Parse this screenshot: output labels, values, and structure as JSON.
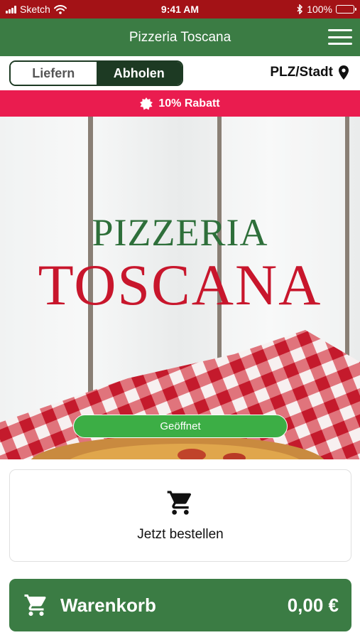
{
  "status_bar": {
    "carrier": "Sketch",
    "time": "9:41 AM",
    "battery": "100%",
    "icons": [
      "signal-icon",
      "wifi-icon",
      "bluetooth-icon",
      "battery-icon"
    ]
  },
  "nav": {
    "title": "Pizzeria Toscana",
    "menu_icon": "hamburger-menu-icon"
  },
  "mode": {
    "options": [
      "Liefern",
      "Abholen"
    ],
    "selected": "Abholen",
    "location_label": "PLZ/Stadt",
    "location_icon": "map-pin-icon"
  },
  "discount": {
    "label": "10% Rabatt",
    "icon": "badge-icon"
  },
  "hero": {
    "brand_line1": "PIZZERIA",
    "brand_line2": "TOSCANA",
    "status": "Geöffnet"
  },
  "order": {
    "label": "Jetzt bestellen",
    "icon": "cart-icon"
  },
  "cart": {
    "label": "Warenkorb",
    "total": "0,00 €",
    "icon": "cart-icon"
  },
  "colors": {
    "status_bar": "#a31216",
    "brand_green": "#3b7c44",
    "dark_green": "#1d3a23",
    "discount": "#ea1c4f",
    "open_green": "#3cae45",
    "brand_red": "#c8162c"
  }
}
